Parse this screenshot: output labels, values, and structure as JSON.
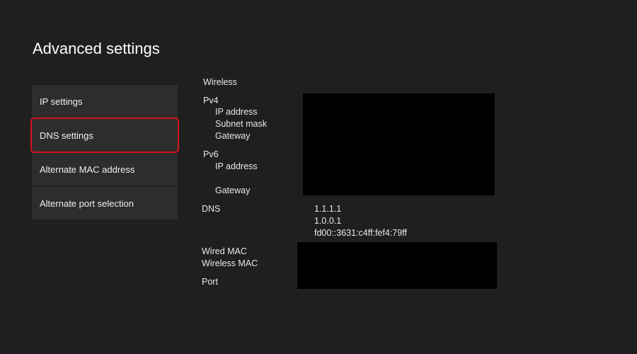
{
  "header": {
    "title": "Advanced settings"
  },
  "menu": {
    "items": [
      {
        "label": "IP settings",
        "selected": false
      },
      {
        "label": "DNS settings",
        "selected": true
      },
      {
        "label": "Alternate MAC address",
        "selected": false
      },
      {
        "label": "Alternate port selection",
        "selected": false
      }
    ]
  },
  "network_info": {
    "connection_type": "Wireless",
    "ipv4": {
      "heading": "Pv4",
      "ip_label": "IP address",
      "subnet_label": "Subnet mask",
      "gateway_label": "Gateway"
    },
    "ipv6": {
      "heading": "Pv6",
      "ip_label": "IP address",
      "gateway_label": "Gateway"
    },
    "dns": {
      "label": "DNS",
      "values": [
        "1.1.1.1",
        "1.0.0.1",
        "fd00::3631:c4ff:fef4:79ff"
      ]
    },
    "wired_mac_label": "Wired MAC",
    "wireless_mac_label": "Wireless MAC",
    "port_label": "Port"
  },
  "colors": {
    "background": "#1f1f1f",
    "menu_item": "#2d2d2d",
    "selection_outline": "#d4121f",
    "redaction": "#000000"
  }
}
